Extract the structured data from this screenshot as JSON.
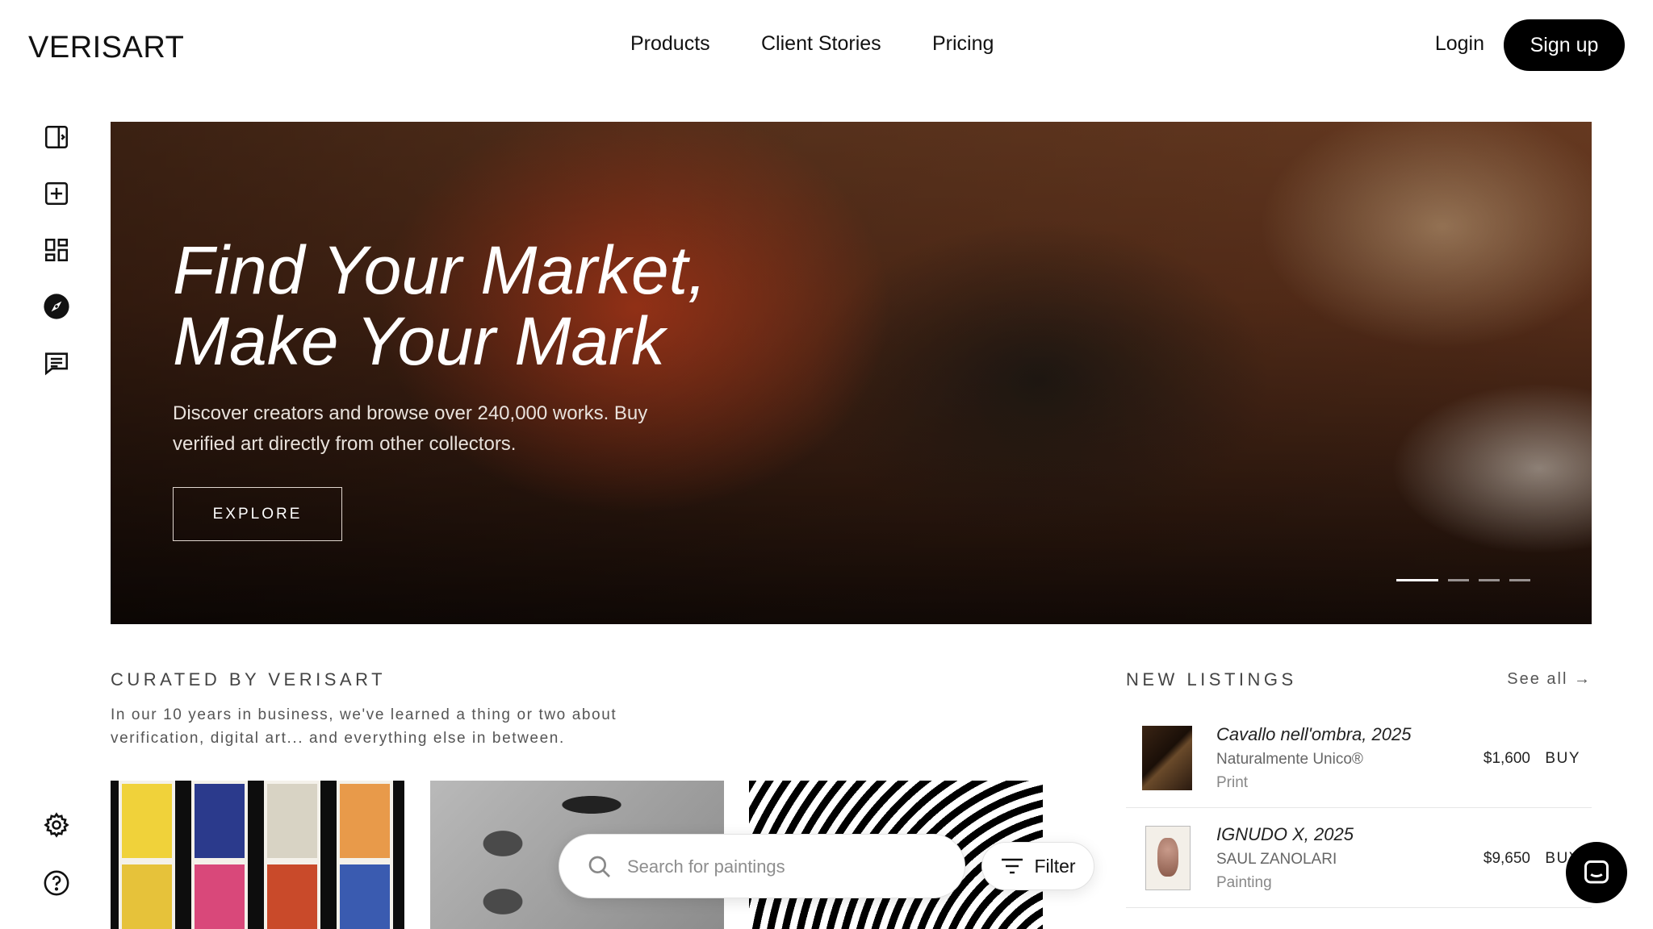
{
  "header": {
    "logo": "VERISART",
    "nav": [
      {
        "label": "Products"
      },
      {
        "label": "Client Stories"
      },
      {
        "label": "Pricing"
      }
    ],
    "login_label": "Login",
    "signup_label": "Sign up"
  },
  "sidebar": {
    "icons": [
      "panel-toggle-icon",
      "add-icon",
      "dashboard-icon",
      "explore-compass-icon",
      "messages-icon",
      "settings-gear-icon",
      "help-icon"
    ]
  },
  "hero": {
    "title_line1": "Find Your Market,",
    "title_line2": "Make Your Mark",
    "subtitle": "Discover creators and browse over 240,000 works. Buy verified art directly from other collectors.",
    "cta_label": "EXPLORE",
    "slide_count": 4,
    "active_slide": 1
  },
  "curated": {
    "title": "CURATED BY VERISART",
    "description": "In our 10 years in business, we've learned a thing or two about verification, digital art... and everything else in between."
  },
  "search": {
    "placeholder": "Search for paintings",
    "value": "",
    "filter_label": "Filter"
  },
  "new_listings": {
    "title": "NEW LISTINGS",
    "see_all_label": "See all →",
    "items": [
      {
        "title": "Cavallo nell'ombra, 2025",
        "artist": "Naturalmente Unico®",
        "type": "Print",
        "price": "$1,600",
        "buy_label": "BUY"
      },
      {
        "title": "IGNUDO X, 2025",
        "artist": "SAUL ZANOLARI",
        "type": "Painting",
        "price": "$9,650",
        "buy_label": "BUY"
      }
    ]
  },
  "colors": {
    "accent": "#000000",
    "text": "#111111",
    "muted": "#555555",
    "hero_orange": "#c8411e"
  }
}
